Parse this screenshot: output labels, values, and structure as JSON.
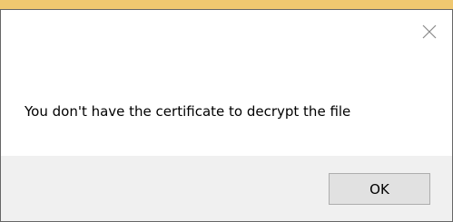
{
  "dialog": {
    "message": "You don't have the certificate to decrypt the file",
    "ok_label": "OK",
    "close_icon": "close-icon"
  },
  "colors": {
    "footer_background": "#f0f0f0",
    "button_background": "#e1e1e1",
    "button_border": "#adadad",
    "window_border": "#666666",
    "accent_strip": "#f0c870"
  }
}
